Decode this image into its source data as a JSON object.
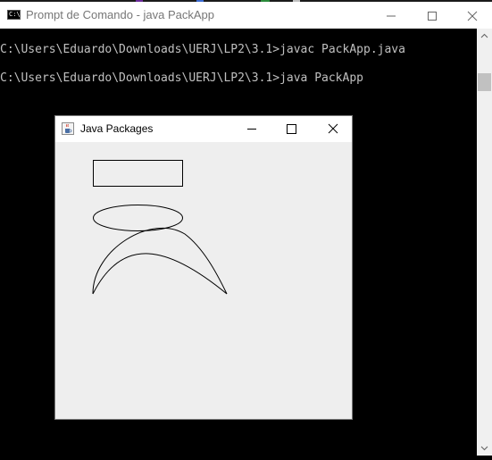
{
  "console": {
    "title": "Prompt de Comando - java  PackApp",
    "icon": "cmd-icon",
    "icon_text": "C:\\",
    "lines": [
      "C:\\Users\\Eduardo\\Downloads\\UERJ\\LP2\\3.1>javac PackApp.java",
      "C:\\Users\\Eduardo\\Downloads\\UERJ\\LP2\\3.1>java PackApp"
    ],
    "text_color": "#c0c0c0",
    "background": "#000000"
  },
  "java_window": {
    "title": "Java Packages",
    "icon": "java-cup-icon",
    "background": "#eeeeee",
    "shapes": [
      "rectangle",
      "ellipse",
      "arc",
      "arc"
    ]
  },
  "window_controls": {
    "minimize_icon": "minimize-icon",
    "maximize_icon": "maximize-icon",
    "close_icon": "close-icon"
  }
}
